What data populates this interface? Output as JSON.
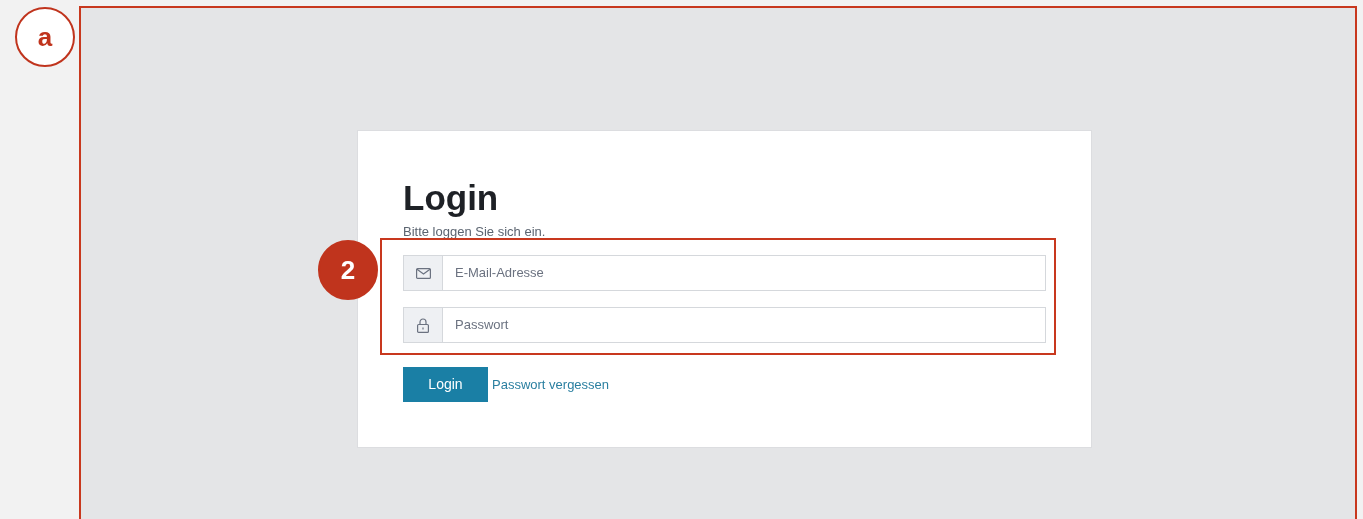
{
  "markers": [
    {
      "label": "a",
      "kind": "outline"
    },
    {
      "label": "2",
      "kind": "filled"
    }
  ],
  "login": {
    "title": "Login",
    "subtitle": "Bitte loggen Sie sich ein.",
    "fields": [
      {
        "kind": "email",
        "placeholder": "E-Mail-Adresse"
      },
      {
        "kind": "password",
        "placeholder": "Passwort"
      }
    ],
    "button": "Login",
    "link": "Passwort vergessen"
  }
}
